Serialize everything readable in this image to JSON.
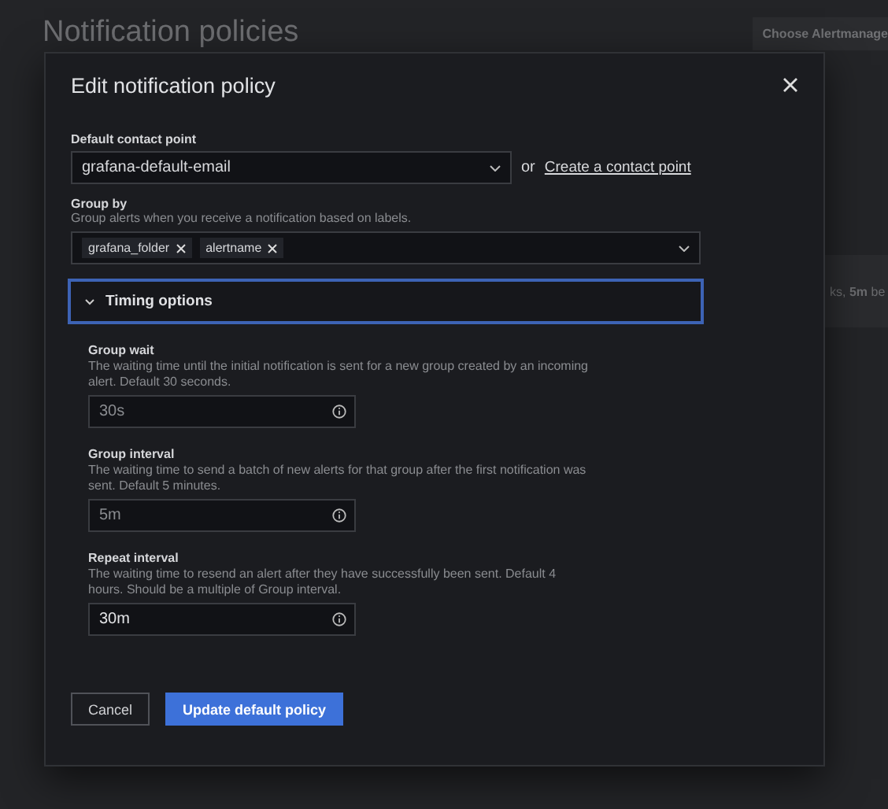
{
  "page": {
    "title": "Notification policies",
    "alertmanager_button": "Choose Alertmanage",
    "background_text": "ks, **5m** be"
  },
  "dialog": {
    "title": "Edit notification policy",
    "contact_point": {
      "label": "Default contact point",
      "value": "grafana-default-email",
      "or": "or",
      "link": "Create a contact point"
    },
    "group_by": {
      "label": "Group by",
      "description": "Group alerts when you receive a notification based on labels.",
      "tags": [
        "grafana_folder",
        "alertname"
      ]
    },
    "timing": {
      "title": "Timing options",
      "expanded": true,
      "fields": [
        {
          "label": "Group wait",
          "description": "The waiting time until the initial notification is sent for a new group created by an incoming alert. Default 30 seconds.",
          "placeholder": "30s"
        },
        {
          "label": "Group interval",
          "description": "The waiting time to send a batch of new alerts for that group after the first notification was sent. Default 5 minutes.",
          "placeholder": "5m"
        },
        {
          "label": "Repeat interval",
          "description": "The waiting time to resend an alert after they have successfully been sent. Default 4 hours. Should be a multiple of Group interval.",
          "value": "30m"
        }
      ]
    },
    "buttons": {
      "cancel": "Cancel",
      "submit": "Update default policy"
    }
  }
}
